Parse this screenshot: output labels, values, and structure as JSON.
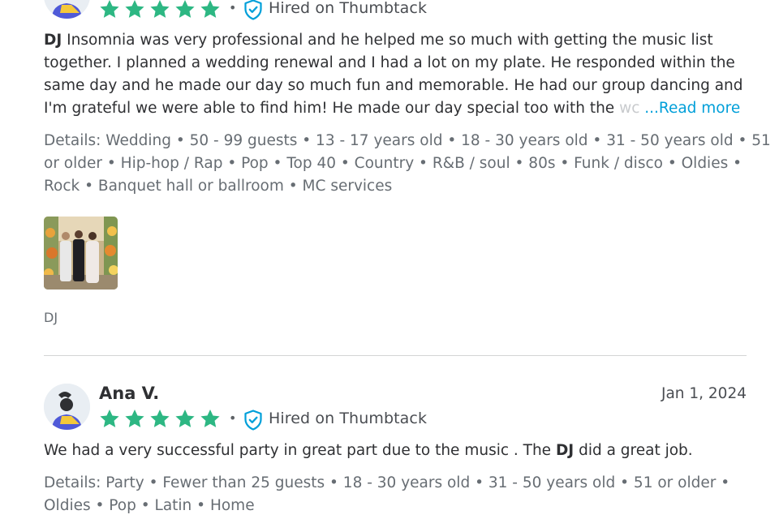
{
  "review1": {
    "rating": 5,
    "hired_label": "Hired on Thumbtack",
    "separator": "•",
    "text_lines": [
      "Insomnia was very professional and he helped me so much with getting the music list",
      "together. I planned a wedding renewal and I had a lot on my plate. He responded within the",
      "same day and he made our day so much fun and memorable. He had our group dancing and",
      "I'm grateful we were able to find him! He made our day special too with the"
    ],
    "bold_lead": "DJ",
    "faded_tail": "wc",
    "read_more": "...Read more",
    "details_lines": [
      "Details: Wedding • 50 - 99 guests • 13 - 17 years old • 18 - 30 years old • 31 - 50 years old • 51",
      "or older • Hip-hop / Rap • Pop • Top 40 • Country • R&B / soul • 80s • Funk / disco • Oldies •",
      "Rock • Banquet hall or ballroom • MC services"
    ],
    "photo_caption": "DJ"
  },
  "review2": {
    "reviewer_name": "Ana V.",
    "date": "Jan 1, 2024",
    "rating": 5,
    "hired_label": "Hired on Thumbtack",
    "separator": "•",
    "text_before": "We had a very successful party in great part due to the music . The ",
    "text_bold": "DJ",
    "text_after": " did a great job.",
    "details_lines": [
      "Details: Party • Fewer than 25 guests • 18 - 30 years old • 31 - 50 years old • 51 or older •",
      "Oldies • Pop • Latin • Home"
    ]
  },
  "colors": {
    "star": "#2db783",
    "link": "#009fd9",
    "shield": "#009fd9",
    "avatar_bg": "#e9eef3",
    "avatar_body": "#4f5ad8",
    "avatar_accent": "#f4c83a"
  },
  "icons": {
    "star": "star-icon",
    "shield": "shield-check-icon",
    "avatar": "avatar-icon"
  }
}
